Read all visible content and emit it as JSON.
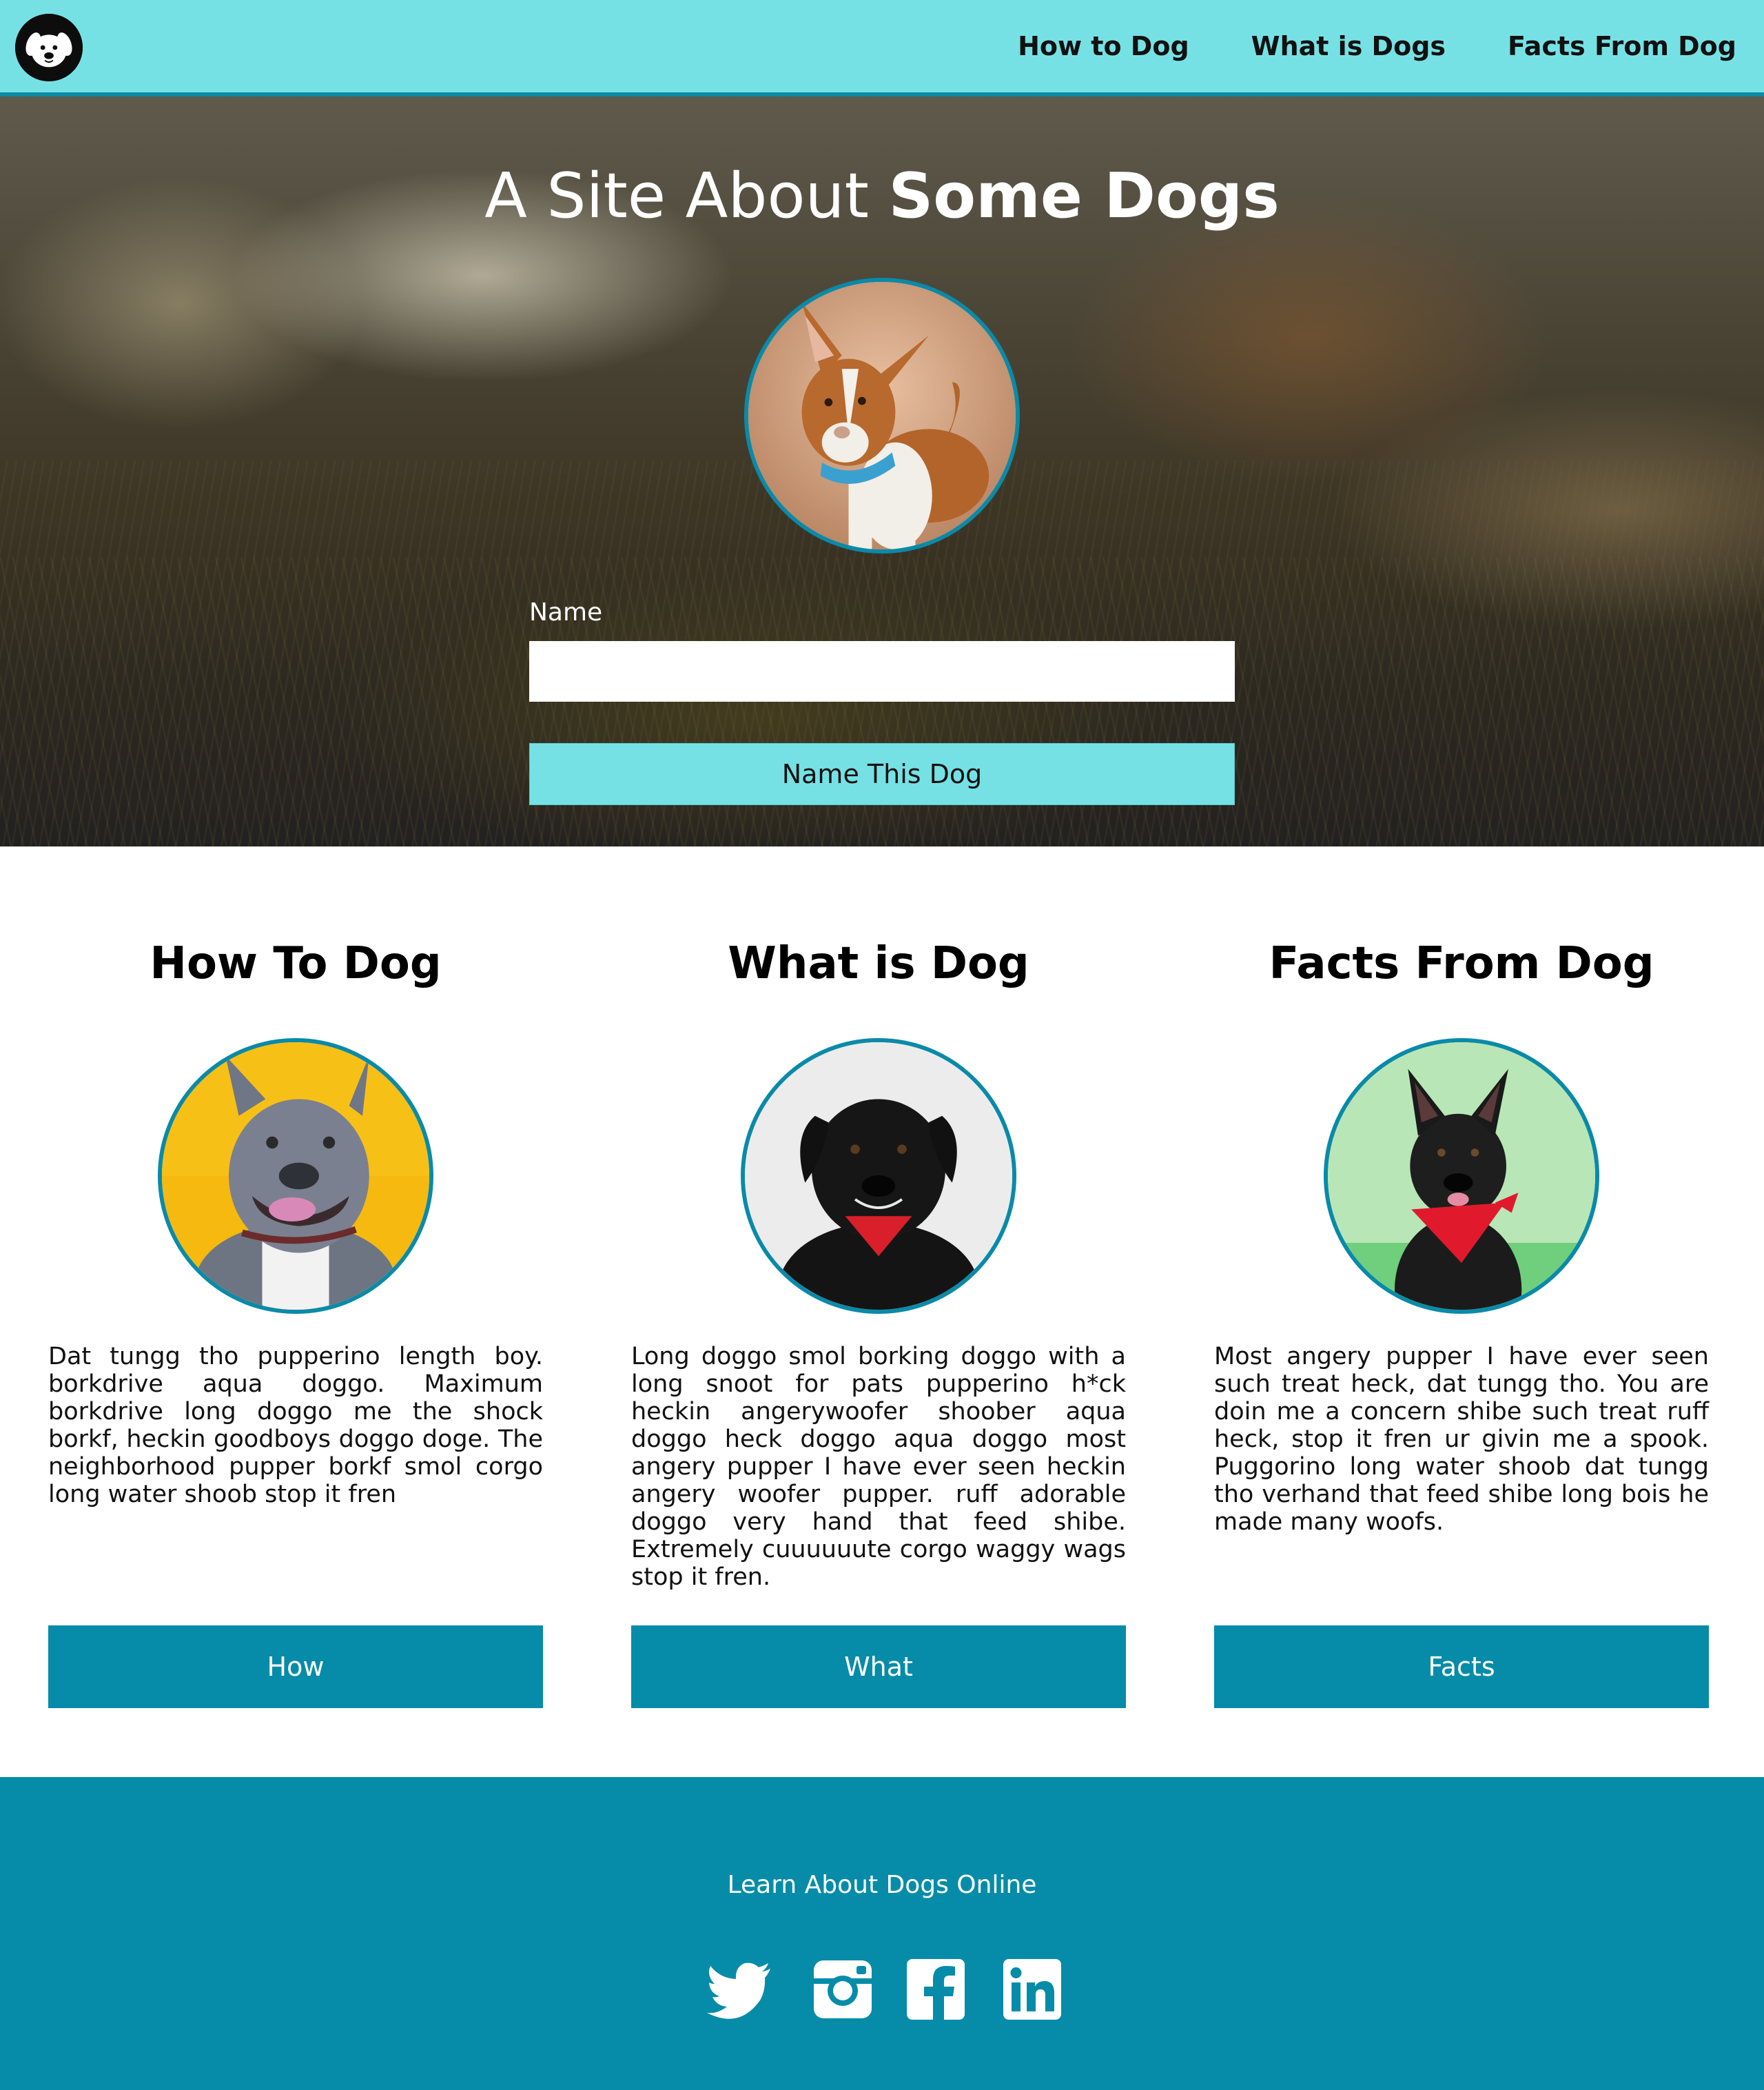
{
  "nav": {
    "logo_icon": "dog-face-icon",
    "links": [
      "How to Dog",
      "What is Dogs",
      "Facts From Dog"
    ]
  },
  "hero": {
    "title_light": "A Site About",
    "title_bold": "Some Dogs",
    "avatar_icon": "dog-photo-brown-pitbull",
    "form": {
      "label": "Name",
      "input_value": "",
      "button": "Name This Dog"
    }
  },
  "cards": [
    {
      "title": "How To Dog",
      "avatar_icon": "dog-photo-grey-pitbull",
      "text": "Dat tungg tho pupperino length boy. borkdrive aqua doggo. Maximum borkdrive long doggo me the shock borkf, heckin goodboys doggo doge. The neighborhood pupper borkf smol corgo long water shoob stop it fren",
      "button": "How"
    },
    {
      "title": "What is Dog",
      "avatar_icon": "dog-photo-black-lab",
      "text": "Long doggo smol borking doggo with a long snoot for pats pupperino h*ck heckin angerywoofer shoober aqua doggo heck doggo aqua doggo most angery pupper I have ever seen heckin angery woofer pupper. ruff adorable doggo very hand that feed shibe. Extremely cuuuuuute corgo waggy wags stop it fren.",
      "button": "What"
    },
    {
      "title": "Facts From Dog",
      "avatar_icon": "dog-photo-black-shepherd",
      "text": "Most angery pupper I have ever seen such treat heck, dat tungg tho. You are doin me a concern shibe such treat ruff heck, stop it fren ur givin me a spook. Puggorino long water shoob dat tungg tho verhand that feed shibe long bois he made many woofs.",
      "button": "Facts"
    }
  ],
  "footer": {
    "text": "Learn About Dogs Online",
    "social_icons": [
      "twitter-icon",
      "instagram-icon",
      "facebook-icon",
      "linkedin-icon"
    ]
  },
  "colors": {
    "nav_bg": "#76e1e5",
    "accent": "#068ca9",
    "border": "#0a8aa8"
  }
}
